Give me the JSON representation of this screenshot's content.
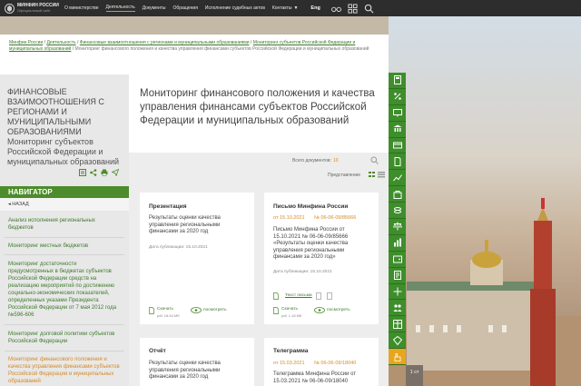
{
  "header": {
    "logo_name": "МИНФИН РОССИИ",
    "logo_sub": "Официальный сайт",
    "menu": [
      "О министерстве",
      "Деятельность",
      "Документы",
      "Обращения",
      "Исполнение судебных актов",
      "Контакты"
    ],
    "lang": "Eng",
    "icons": [
      "glasses-icon",
      "grid-icon",
      "search-icon"
    ]
  },
  "breadcrumb": {
    "items": [
      "Минфин России",
      "Деятельность",
      "Финансовые взаимоотношения с регионами и муниципальными образованиями",
      "Мониторинг субъектов Российской Федерации и муниципальных образований"
    ],
    "current": "Мониторинг финансового положения и качества управления финансами субъектов Российской Федерации и муниципальных образований",
    "separator": "/"
  },
  "sidebar": {
    "title": "ФИНАНСОВЫЕ ВЗАИМООТНОШЕНИЯ С РЕГИОНАМИ И МУНИЦИПАЛЬНЫМИ ОБРАЗОВАНИЯМИ",
    "subtitle": "Мониторинг субъектов Российской Федерации и муниципальных образований",
    "nav_title": "НАВИГАТОР",
    "back": "НАЗАД",
    "links": [
      "Анализ исполнения региональных бюджетов",
      "Мониторинг местных бюджетов",
      "Мониторинг достаточности предусмотренных в бюджетах субъектов Российской Федерации средств на реализацию мероприятий по достижению социально-экономических показателей, определенных указами Президента Российской Федерации от 7 мая 2012 года №596-606",
      "Мониторинг долговой политики субъектов Российской Федерации",
      "Мониторинг финансового положения и качества управления финансами субъектов Российской Федерации и муниципальных образований"
    ],
    "tool_icons": [
      "sitemap-icon",
      "share-icon",
      "print-icon",
      "send-icon"
    ]
  },
  "main": {
    "title": "Мониторинг финансового положения и качества управления финансами субъектов Российской Федерации и муниципальных образований",
    "count_label": "Всего документов:",
    "count_value": "10",
    "view_label": "Представление"
  },
  "cards": [
    {
      "type": "Презентация",
      "text": "Результаты оценки качества управления региональными финансами за 2020 год",
      "date": "Дата публикации: 15.10.2021",
      "download": "Скачать",
      "size": "pdf, 16.54 Мб",
      "view": "посмотреть"
    },
    {
      "type": "Письмо Минфина России",
      "meta_date": "от 15.10.2021",
      "meta_num": "№ 06-06-09/85666",
      "text": "Письмо Минфина России от 15.10.2021 № 06-06-09/85666 «Результаты оценки качества управления региональными финансами за 2020 год»",
      "date": "Дата публикации: 15.10.2021",
      "letter": "Текст письма",
      "download": "Скачать",
      "size": "pdf, 1.18 Мб",
      "view": "посмотреть"
    },
    {
      "type": "Отчёт",
      "text": "Результаты оценки качества управления региональными финансами за 2020 год"
    },
    {
      "type": "Телеграмма",
      "meta_date": "от 15.03.2021",
      "meta_num": "№ 06-06-09/18040",
      "text": "Телеграмма Минфина России от 15.03.2021 № 06-06-09/18040"
    }
  ],
  "right_strip": {
    "icons": [
      "calculator-icon",
      "percent-icon",
      "monitor-icon",
      "bank-icon",
      "card-icon",
      "document-icon",
      "chart-icon",
      "bag-icon",
      "coins-icon",
      "scales-icon",
      "bars-icon",
      "wallet-icon",
      "contract-icon",
      "arrows-icon",
      "people-icon",
      "table-icon",
      "diamond-icon",
      "hand-icon"
    ],
    "badge": "1 ст"
  },
  "colors": {
    "accent_green": "#4c8c2a",
    "link_green": "#3f7a2e",
    "orange": "#d58a28",
    "topbar": "#2d2d2d"
  }
}
